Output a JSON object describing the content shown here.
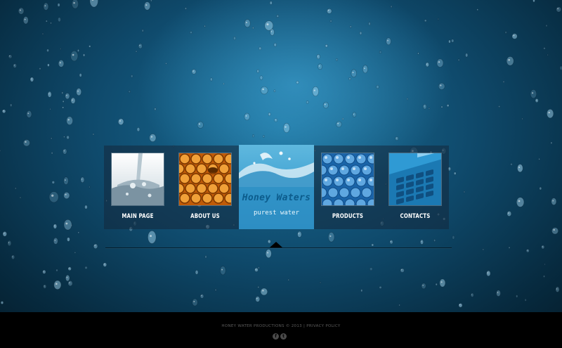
{
  "navigation": {
    "items": [
      {
        "label": "MAIN PAGE",
        "icon": "water-splash-thumb"
      },
      {
        "label": "ABOUT US",
        "icon": "honeycomb-thumb"
      },
      {
        "label": "PRODUCTS",
        "icon": "water-bottles-thumb"
      },
      {
        "label": "CONTACTS",
        "icon": "telephone-keypad-thumb"
      }
    ],
    "home": {
      "title": "Honey Waters",
      "subtitle": "purest water"
    }
  },
  "footer": {
    "copyright": "HONEY WATER PRODUCTIONS © 2013",
    "separator": "|",
    "privacy": "PRIVACY POLICY",
    "social": [
      {
        "icon": "facebook-icon",
        "glyph": "f"
      },
      {
        "icon": "twitter-icon",
        "glyph": "t"
      }
    ]
  },
  "colors": {
    "background": "#0f4a6c",
    "home_card": "#3b9ed0",
    "footer": "#000000"
  }
}
